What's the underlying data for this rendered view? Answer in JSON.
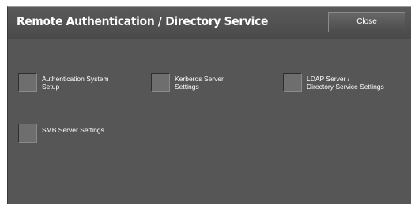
{
  "header": {
    "title": "Remote Authentication / Directory Service",
    "close_label": "Close"
  },
  "options": [
    {
      "line1": "Authentication System",
      "line2": "Setup"
    },
    {
      "line1": "Kerberos Server",
      "line2": "Settings"
    },
    {
      "line1": "LDAP Server /",
      "line2": "Directory Service Settings"
    },
    {
      "line1": "SMB Server Settings",
      "line2": ""
    }
  ]
}
